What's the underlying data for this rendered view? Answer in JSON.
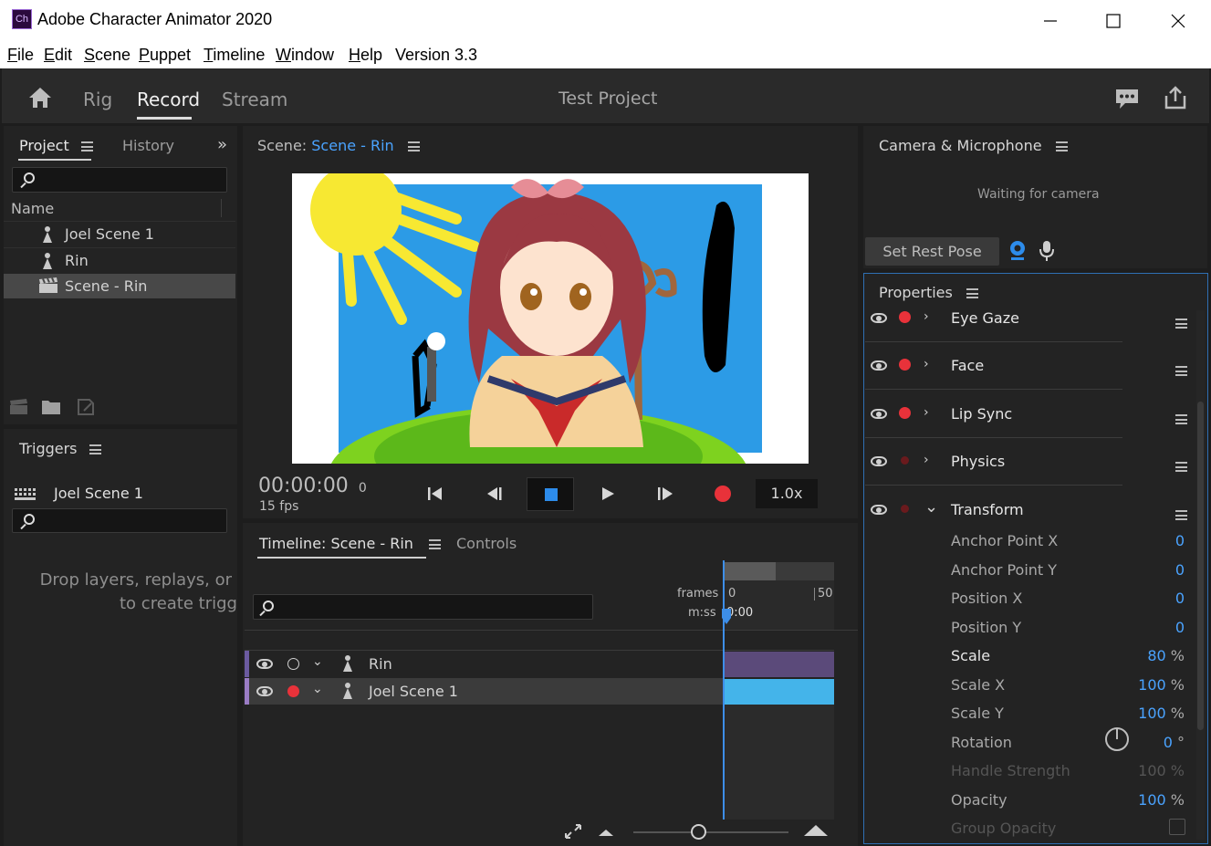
{
  "window": {
    "app_icon": "Ch",
    "title": "Adobe Character Animator 2020",
    "controls": [
      "minimize-icon",
      "maximize-icon",
      "close-icon"
    ]
  },
  "menu": {
    "items": [
      {
        "u": "F",
        "rest": "ile"
      },
      {
        "u": "E",
        "rest": "dit"
      },
      {
        "u": "S",
        "rest": "cene"
      },
      {
        "u": "P",
        "rest": "uppet"
      },
      {
        "u": "T",
        "rest": "imeline"
      },
      {
        "u": "W",
        "rest": "indow"
      },
      {
        "u": "H",
        "rest": "elp"
      }
    ],
    "version": "Version 3.3"
  },
  "workspace": {
    "tabs": [
      "Rig",
      "Record",
      "Stream"
    ],
    "active": "Record",
    "project_title": "Test Project",
    "icons": [
      "home-icon",
      "feedback-icon",
      "share-icon"
    ]
  },
  "project_panel": {
    "tabs": [
      "Project",
      "History"
    ],
    "name_header": "Name",
    "items": [
      {
        "label": "Joel Scene 1",
        "icon": "puppet-icon"
      },
      {
        "label": "Rin",
        "icon": "puppet-icon"
      },
      {
        "label": "Scene - Rin",
        "icon": "scene-icon"
      }
    ],
    "footer_icons": [
      "new-scene-icon",
      "folder-icon",
      "new-item-icon"
    ]
  },
  "triggers_panel": {
    "title": "Triggers",
    "item": "Joel Scene 1",
    "drop_text_1": "Drop layers, replays, or",
    "drop_text_2": "to create trigge"
  },
  "scene_panel": {
    "label": "Scene:",
    "scene_name": "Scene - Rin",
    "timecode": "00:00:00",
    "frame": "0",
    "fps": "15 fps",
    "speed": "1.0x",
    "transport_icons": [
      "go-to-start-icon",
      "step-back-icon",
      "stop-icon",
      "play-icon",
      "step-forward-icon",
      "record-icon"
    ]
  },
  "timeline_panel": {
    "tabs": [
      "Timeline: Scene - Rin",
      "Controls"
    ],
    "ruler_frames_label": "frames",
    "ruler_mss_label": "m:ss",
    "ruler_frame_start": "0",
    "ruler_frame_end": "50",
    "playhead_time": "0:00",
    "tracks": [
      {
        "label": "Rin",
        "armed": false,
        "color": "#5b4a7a"
      },
      {
        "label": "Joel Scene 1",
        "armed": true,
        "color": "#44b4ea"
      }
    ],
    "zoom_slider": 0.5
  },
  "camera_panel": {
    "title": "Camera & Microphone",
    "status": "Waiting for camera",
    "rest_pose_button": "Set Rest Pose"
  },
  "properties_panel": {
    "title": "Properties",
    "behaviors": [
      {
        "label": "Eye Gaze",
        "armed": true,
        "expanded": false
      },
      {
        "label": "Face",
        "armed": true,
        "expanded": false
      },
      {
        "label": "Lip Sync",
        "armed": true,
        "expanded": false
      },
      {
        "label": "Physics",
        "armed": false,
        "expanded": false
      },
      {
        "label": "Transform",
        "armed": false,
        "expanded": true
      }
    ],
    "params": [
      {
        "name": "Anchor Point X",
        "value": "0",
        "unit": ""
      },
      {
        "name": "Anchor Point Y",
        "value": "0",
        "unit": ""
      },
      {
        "name": "Position X",
        "value": "0",
        "unit": ""
      },
      {
        "name": "Position Y",
        "value": "0",
        "unit": ""
      },
      {
        "name": "Scale",
        "value": "80",
        "unit": "%"
      },
      {
        "name": "Scale X",
        "value": "100",
        "unit": "%"
      },
      {
        "name": "Scale Y",
        "value": "100",
        "unit": "%"
      },
      {
        "name": "Rotation",
        "value": "0",
        "unit": "°"
      },
      {
        "name": "Handle Strength",
        "value": "100",
        "unit": "%"
      },
      {
        "name": "Opacity",
        "value": "100",
        "unit": "%"
      },
      {
        "name": "Group Opacity",
        "value": "",
        "unit": ""
      }
    ]
  },
  "colors": {
    "accent": "#4aa3ff",
    "record_red": "#e8323a",
    "panel_bg": "#232323",
    "app_bg": "#1d1d1d"
  }
}
